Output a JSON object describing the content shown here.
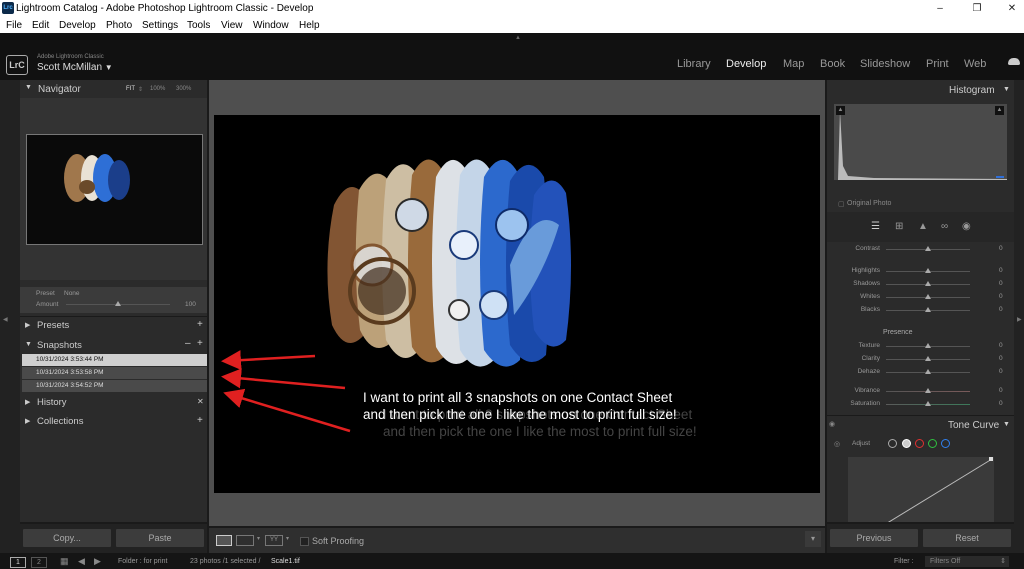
{
  "window": {
    "title": "Lightroom Catalog - Adobe Photoshop Lightroom Classic - Develop",
    "logo_text": "Lrc",
    "controls": [
      "minimize",
      "restore",
      "close"
    ]
  },
  "menubar": [
    "File",
    "Edit",
    "Develop",
    "Photo",
    "Settings",
    "Tools",
    "View",
    "Window",
    "Help"
  ],
  "identity": {
    "badge": "LrC",
    "brand": "Adobe Lightroom Classic",
    "user": "Scott McMillan"
  },
  "modules": [
    "Library",
    "Develop",
    "Map",
    "Book",
    "Slideshow",
    "Print",
    "Web"
  ],
  "active_module": "Develop",
  "navigator": {
    "title": "Navigator",
    "zoom_options": [
      "FIT",
      "100%",
      "300%"
    ]
  },
  "preset_amount": {
    "preset_label": "Preset",
    "preset_value": "None",
    "amount_label": "Amount",
    "amount_value": "100"
  },
  "left_sections": {
    "presets": "Presets",
    "snapshots": "Snapshots",
    "history": "History",
    "collections": "Collections"
  },
  "snapshots": [
    "10/31/2024 3:53:44 PM",
    "10/31/2024 3:53:58 PM",
    "10/31/2024 3:54:52 PM"
  ],
  "left_buttons": {
    "copy": "Copy...",
    "paste": "Paste"
  },
  "toolbar": {
    "soft_proofing": "Soft Proofing"
  },
  "annotation": {
    "line1": "I want to print all 3 snapshots on one Contact Sheet",
    "line2": "and then pick the one I like the most to print full size!"
  },
  "histogram": {
    "title": "Histogram",
    "caption": "Original Photo"
  },
  "basic": {
    "contrast": {
      "label": "Contrast",
      "value": "0"
    },
    "highlights": {
      "label": "Highlights",
      "value": "0"
    },
    "shadows": {
      "label": "Shadows",
      "value": "0"
    },
    "whites": {
      "label": "Whites",
      "value": "0"
    },
    "blacks": {
      "label": "Blacks",
      "value": "0"
    },
    "presence_title": "Presence",
    "texture": {
      "label": "Texture",
      "value": "0"
    },
    "clarity": {
      "label": "Clarity",
      "value": "0"
    },
    "dehaze": {
      "label": "Dehaze",
      "value": "0"
    },
    "vibrance": {
      "label": "Vibrance",
      "value": "0"
    },
    "saturation": {
      "label": "Saturation",
      "value": "0"
    }
  },
  "tone_curve": {
    "title": "Tone Curve",
    "adjust_label": "Adjust"
  },
  "right_buttons": {
    "previous": "Previous",
    "reset": "Reset"
  },
  "filmstrip": {
    "page1": "1",
    "page2": "2",
    "source": "Folder : for print",
    "count": "23 photos /1 selected /",
    "filename": "Scale1.tif",
    "filter_label": "Filter :",
    "filter_value": "Filters Off"
  }
}
